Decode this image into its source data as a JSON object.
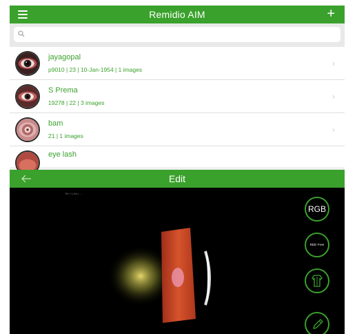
{
  "top_screen": {
    "title": "Remidio AIM",
    "search": {
      "placeholder": "",
      "value": ""
    },
    "patients": [
      {
        "name": "jayagopal",
        "meta": "p9010 | 23 | 10-Jan-1954 | 1 images"
      },
      {
        "name": "S Prema",
        "meta": "19278 | 22 | 3 images"
      },
      {
        "name": "bam",
        "meta": "21 | 1 images"
      },
      {
        "name": "eye lash",
        "meta": ""
      }
    ]
  },
  "edit_screen": {
    "title": "Edit",
    "image_caption": "Tilt: 0 | Iris | ...",
    "tools": {
      "rgb_label": "RGB",
      "redfree_label": "RED Free"
    }
  },
  "colors": {
    "accent": "#3aa12c",
    "list_text": "#3aa12c",
    "background_dark": "#000000"
  },
  "icons": [
    "menu-icon",
    "plus-icon",
    "search-icon",
    "chevron-right-icon",
    "back-arrow-icon",
    "shirt-icon",
    "pencil-icon"
  ]
}
